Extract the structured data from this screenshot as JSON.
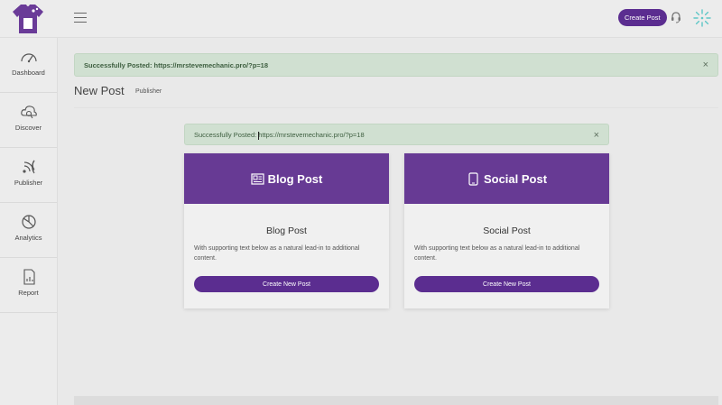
{
  "header": {
    "create_post_label": "Create Post",
    "logo_icon": "tshirt-logo-icon",
    "brand_color": "#5b2d90"
  },
  "sidebar": {
    "items": [
      {
        "label": "Dashboard",
        "icon": "speedometer-icon"
      },
      {
        "label": "Discover",
        "icon": "cloud-search-icon"
      },
      {
        "label": "Publisher",
        "icon": "rss-icon"
      },
      {
        "label": "Analytics",
        "icon": "pie-chart-icon"
      },
      {
        "label": "Report",
        "icon": "report-doc-icon"
      }
    ]
  },
  "alerts": {
    "top": "Successfully Posted: https://mrstevemechanic.pro/?p=18",
    "inner": "Successfully Posted: https://mrstevemechanic.pro/?p=18",
    "close_symbol": "×",
    "color": "#d0e0d1"
  },
  "page": {
    "title": "New Post",
    "subtitle": "Publisher"
  },
  "cards": [
    {
      "header": "Blog Post",
      "title": "Blog Post",
      "text": "With supporting text below as a natural lead-in to additional content.",
      "button": "Create New Post",
      "icon": "newspaper-icon"
    },
    {
      "header": "Social Post",
      "title": "Social Post",
      "text": "With supporting text below as a natural lead-in to additional content.",
      "button": "Create New Post",
      "icon": "mobile-icon"
    }
  ],
  "colors": {
    "card_header": "#673a94",
    "button": "#5b2d90"
  }
}
